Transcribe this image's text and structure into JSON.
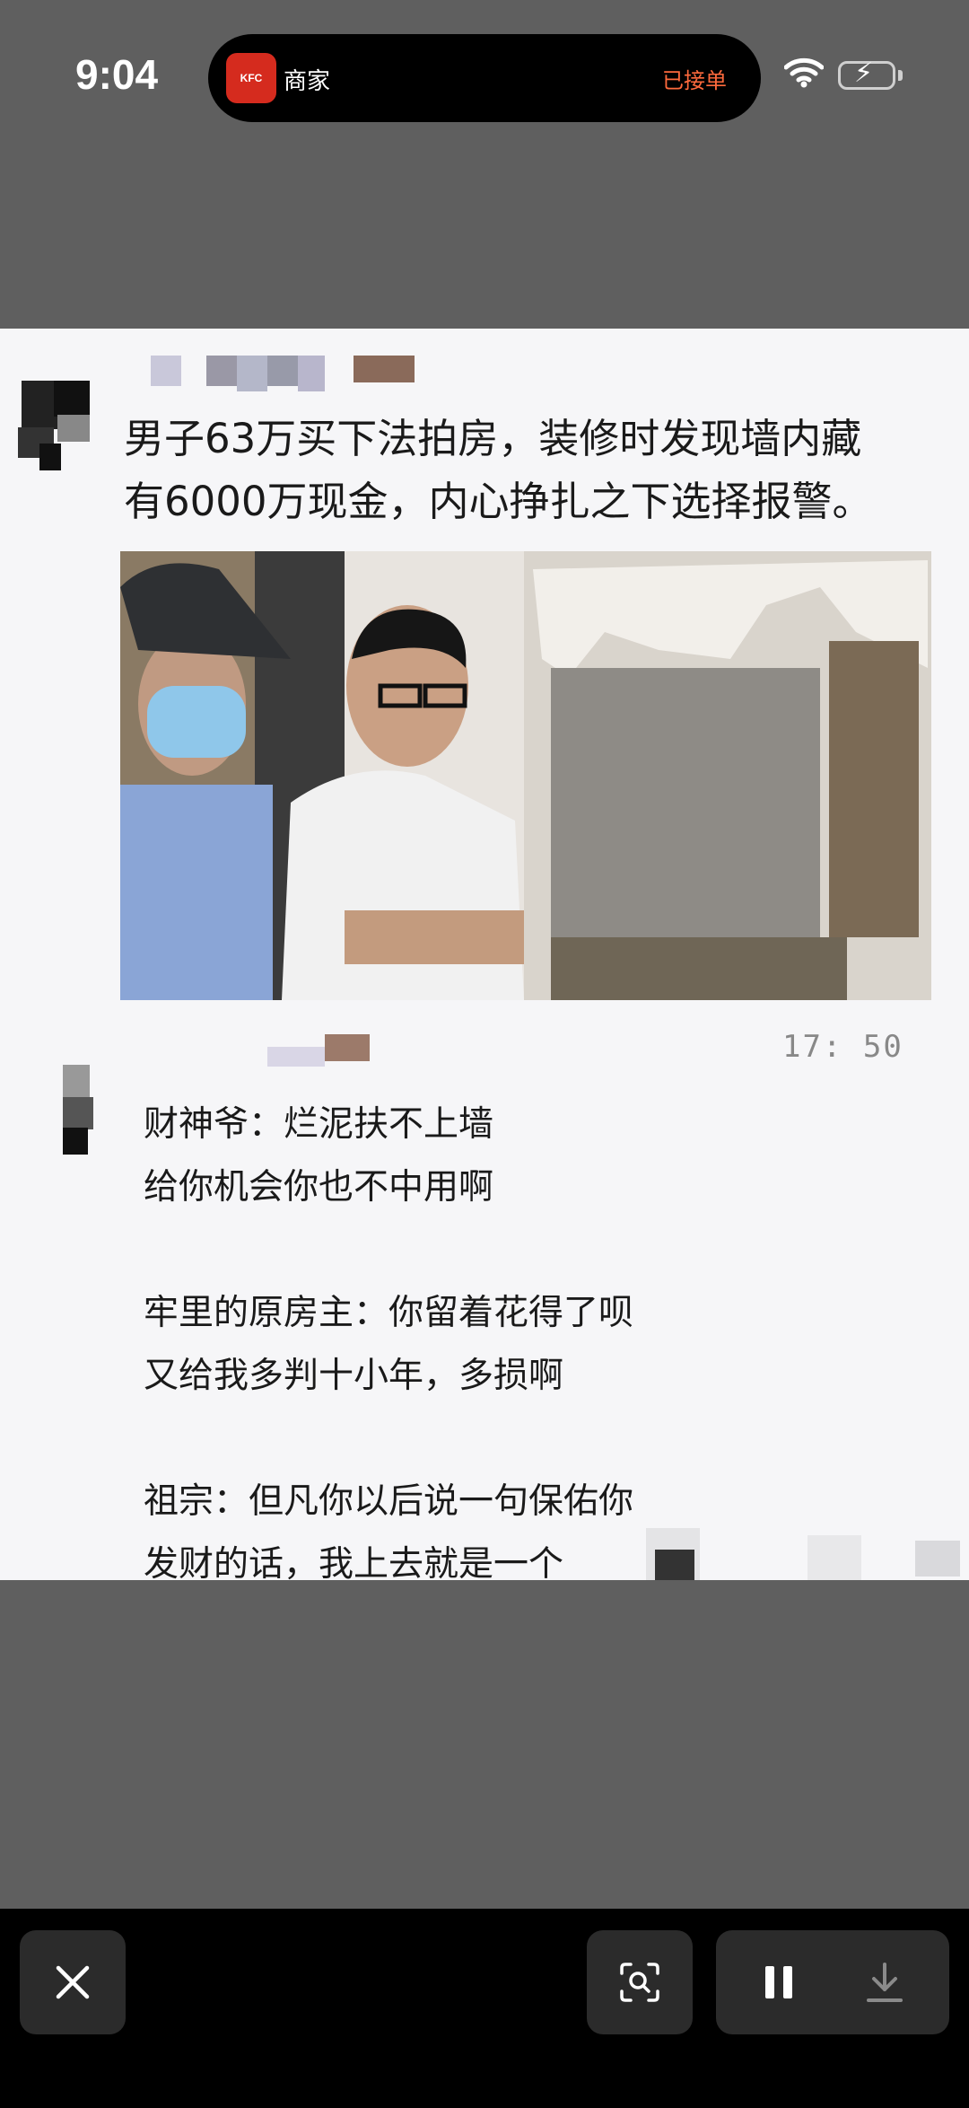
{
  "status_bar": {
    "time": "9:04",
    "live_activity": {
      "app_icon": "kfc-icon",
      "app_name": "商家",
      "status": "已接单",
      "status_color": "#ff6a3d"
    },
    "icons": [
      "wifi-icon",
      "battery-charging-icon"
    ]
  },
  "post": {
    "headline_line1": "男子63万买下法拍房，装修时发现墙内藏",
    "headline_line2": "有6000万现金，内心挣扎之下选择报警。",
    "photo_icon": "news-photo-image"
  },
  "reply": {
    "timestamp": "17: 50",
    "lines": [
      "财神爷：烂泥扶不上墙",
      "给你机会你也不中用啊",
      "牢里的原房主：你留着花得了呗",
      "又给我多判十小年，多损啊",
      "祖宗：但凡你以后说一句保佑你",
      "发财的话，我上去就是一个"
    ]
  },
  "toolbar": {
    "buttons": [
      "close-icon",
      "visual-search-icon",
      "pause-icon",
      "download-icon"
    ]
  }
}
